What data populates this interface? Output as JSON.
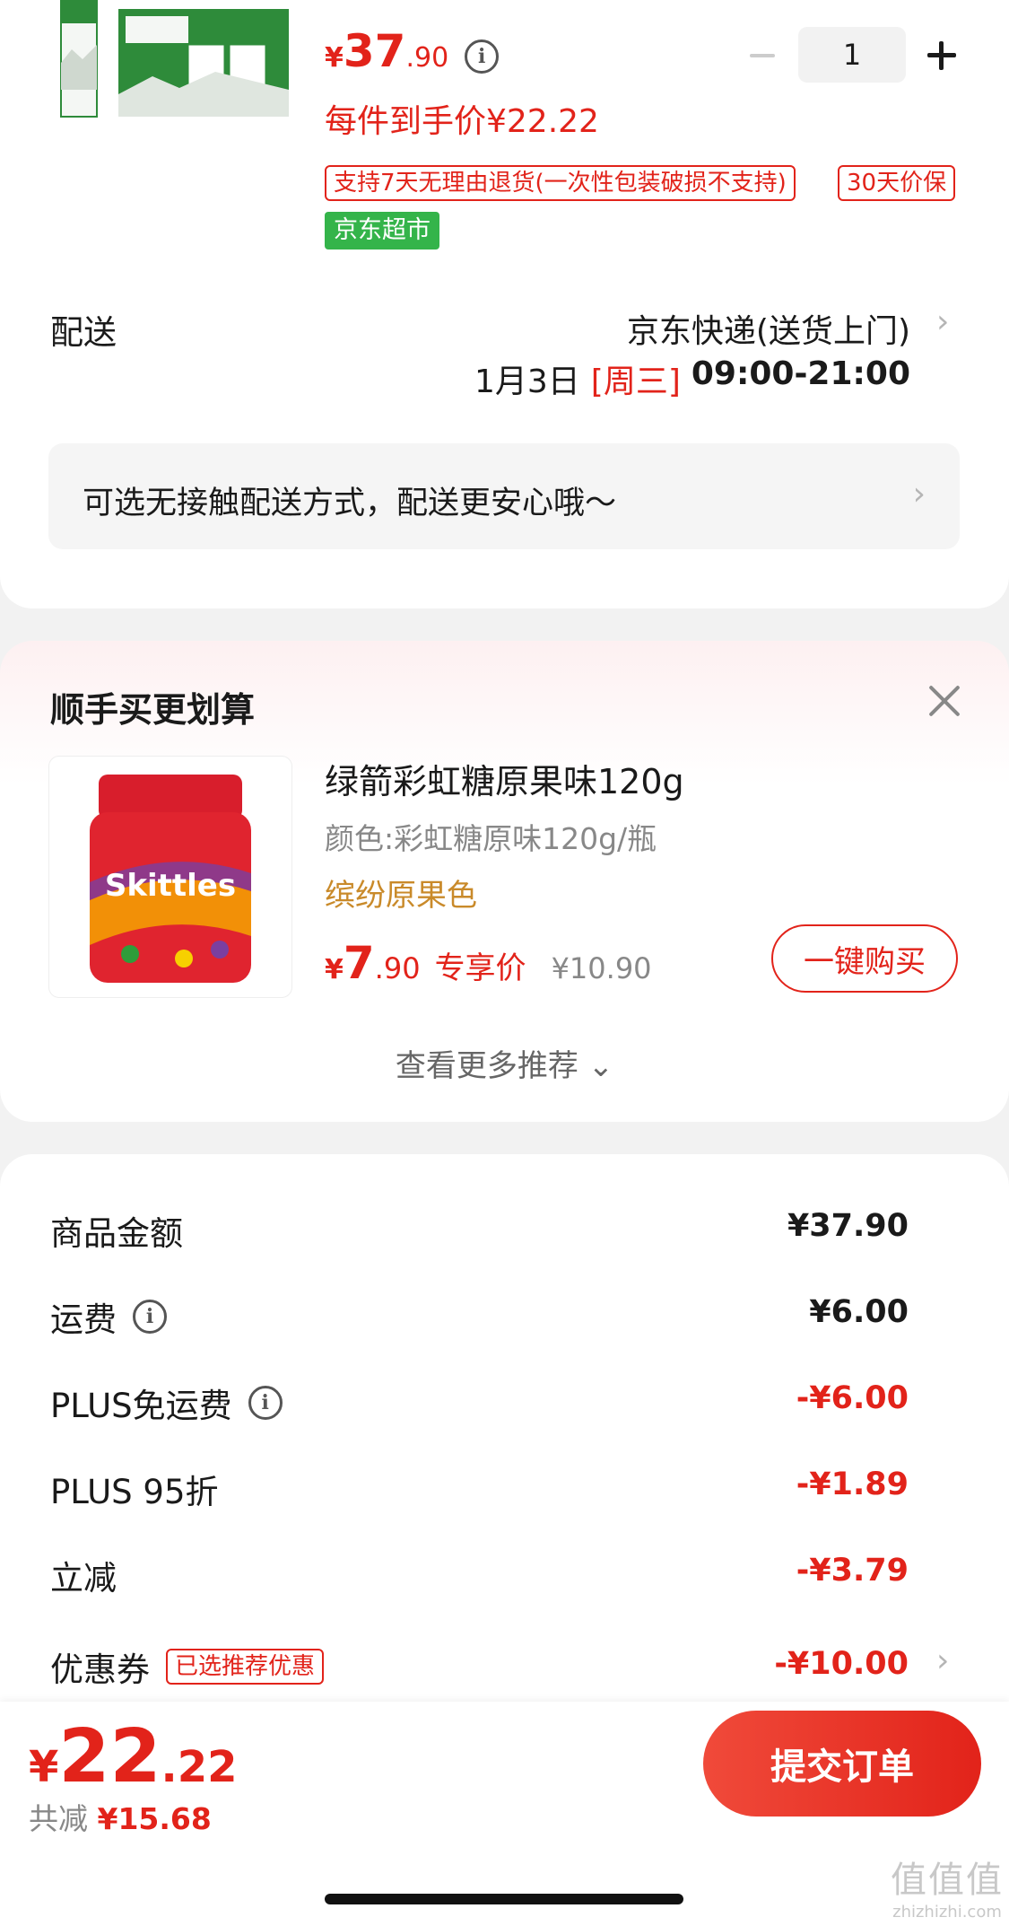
{
  "product": {
    "image_icon": "milk-box-product-image",
    "price_symbol": "¥",
    "price_int": "37",
    "price_dec": ".90",
    "quantity": "1",
    "unit_price": "每件到手价¥22.22",
    "tags": [
      "支持7天无理由退货(一次性包装破损不支持)",
      "30天价保"
    ],
    "store_tag": "京东超市"
  },
  "delivery": {
    "label": "配送",
    "method": "京东快递(送货上门)",
    "date": "1月3日",
    "weekday": "[周三]",
    "time": "09:00-21:00",
    "notice": "可选无接触配送方式，配送更安心哦～"
  },
  "recommend": {
    "title": "顺手买更划算",
    "name": "绿箭彩虹糖原果味120g",
    "spec": "颜色:彩虹糖原味120g/瓶",
    "flavor": "缤纷原果色",
    "price_symbol": "¥",
    "price_int": "7",
    "price_dec": ".90",
    "exclusive": "专享价",
    "original": "¥10.90",
    "buy_label": "一键购买",
    "more_label": "查看更多推荐 ⌄"
  },
  "summary": {
    "rows": [
      {
        "label": "商品金额",
        "value": "¥37.90"
      },
      {
        "label": "运费",
        "value": "¥6.00"
      },
      {
        "label": "PLUS免运费",
        "value": "-¥6.00"
      },
      {
        "label": "PLUS 95折",
        "value": "-¥1.89"
      },
      {
        "label": "立减",
        "value": "-¥3.79"
      },
      {
        "label": "优惠券",
        "value": "-¥10.00",
        "tag": "已选推荐优惠"
      }
    ]
  },
  "footer": {
    "total_symbol": "¥",
    "total_int": "22",
    "total_dec": ".22",
    "saved_label": "共减",
    "saved_amount": "¥15.68",
    "submit_label": "提交订单",
    "watermark_big": "值值值",
    "watermark_small": "zhizhizhi.com"
  },
  "colors": {
    "accent": "#e2231a",
    "green": "#34b44a",
    "flavor": "#c98a2a"
  }
}
